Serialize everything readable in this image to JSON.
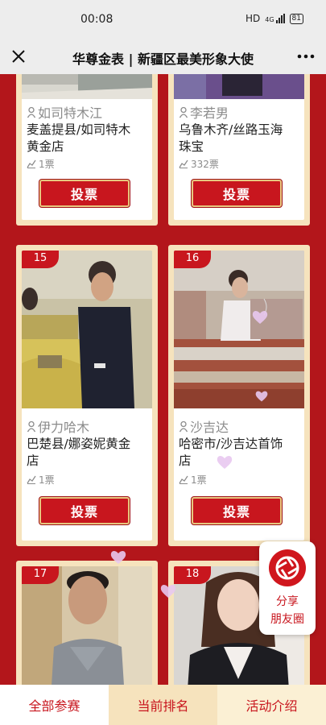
{
  "status_bar": {
    "time": "00:08",
    "network": "HD",
    "signal_text": "4G",
    "battery": "81"
  },
  "nav": {
    "title": "华尊金表 | 新疆区最美形象大使"
  },
  "cards": [
    {
      "number": "",
      "name": "如司特木江",
      "store_line1": "麦盖提县/如司特木",
      "store_line2": "黄金店",
      "votes": "1票",
      "vote_label": "投票"
    },
    {
      "number": "",
      "name": "李若男",
      "store_line1": "乌鲁木齐/丝路玉海",
      "store_line2": "珠宝",
      "votes": "332票",
      "vote_label": "投票"
    },
    {
      "number": "15",
      "name": "伊力哈木",
      "store_line1": "巴楚县/娜姿妮黄金",
      "store_line2": "店",
      "votes": "1票",
      "vote_label": "投票"
    },
    {
      "number": "16",
      "name": "沙吉达",
      "store_line1": "哈密市/沙吉达首饰",
      "store_line2": "店",
      "votes": "1票",
      "vote_label": "投票"
    },
    {
      "number": "17"
    },
    {
      "number": "18"
    }
  ],
  "share": {
    "line1": "分享",
    "line2": "朋友圈"
  },
  "tabs": [
    {
      "label": "全部参赛"
    },
    {
      "label": "当前排名"
    },
    {
      "label": "活动介绍"
    }
  ],
  "colors": {
    "brand_red": "#c8161e",
    "background_red": "#b3161b",
    "card_gold": "#f6e3bd"
  }
}
